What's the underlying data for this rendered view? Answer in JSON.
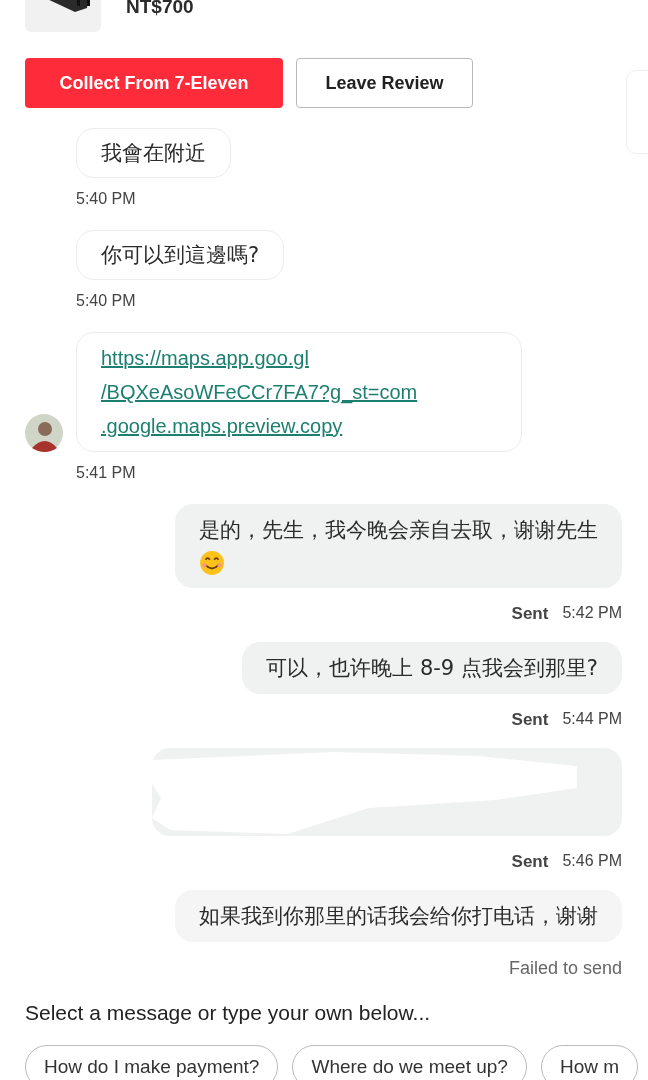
{
  "product": {
    "price": "NT$700"
  },
  "actions": [
    {
      "label": "Collect From 7-Eleven",
      "kind": "primary"
    },
    {
      "label": "Leave Review",
      "kind": "secondary"
    }
  ],
  "messages": [
    {
      "kind": "incoming",
      "text": "我會在附近",
      "time": "5:40 PM",
      "avatar": false
    },
    {
      "kind": "incoming",
      "text": "你可以到這邊嗎?",
      "time": "5:40 PM",
      "avatar": false
    },
    {
      "kind": "link",
      "lines": [
        "https://maps.app.goo.gl",
        "/BQXeAsoWFeCCr7FA7?g_st=com",
        ".google.maps.preview.copy"
      ],
      "time": "5:41 PM",
      "avatar": true
    },
    {
      "kind": "outgoing",
      "text": "是的，先生，我今晚会亲自去取，谢谢先生",
      "emoji": true,
      "status": "Sent",
      "time": "5:42 PM",
      "failed": false
    },
    {
      "kind": "outgoing",
      "text": "可以，也许晚上 8-9 点我会到那里?",
      "emoji": false,
      "status": "Sent",
      "time": "5:44 PM",
      "failed": false
    },
    {
      "kind": "redacted",
      "status": "Sent",
      "time": "5:46 PM",
      "failed": false
    },
    {
      "kind": "outgoing",
      "text": "如果我到你那里的话我会给你打电话，谢谢",
      "emoji": false,
      "status": "Failed to send",
      "failed": true
    }
  ],
  "prompt": "Select a message or type your own below...",
  "suggestions": [
    "How do I make payment?",
    "Where do we meet up?",
    "How m"
  ]
}
